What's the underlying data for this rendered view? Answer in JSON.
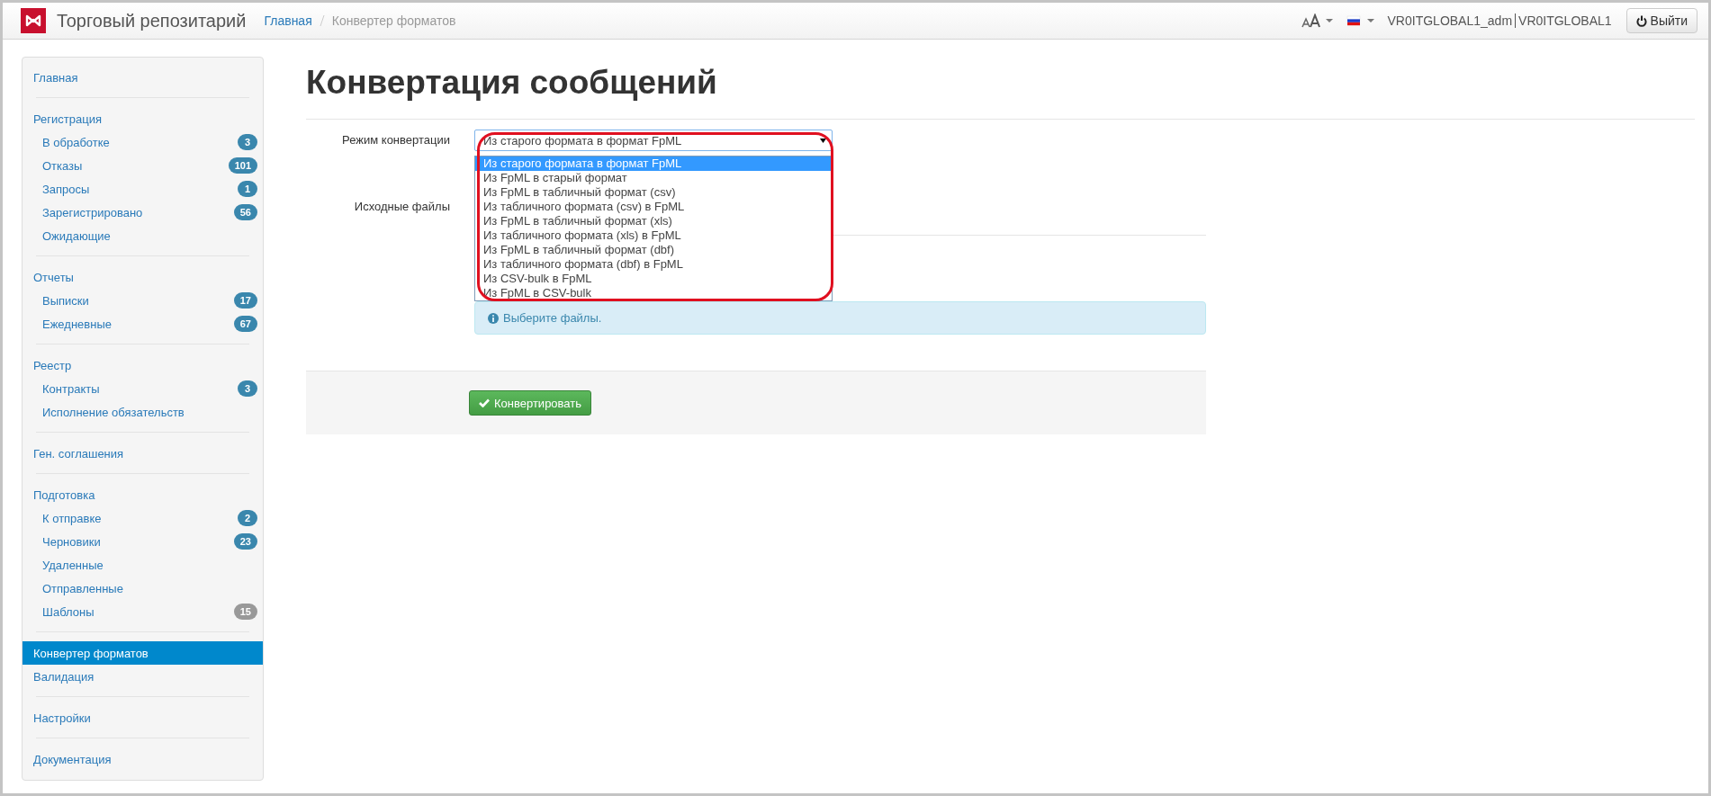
{
  "topbar": {
    "brand": "Торговый репозитарий",
    "breadcrumb": [
      {
        "label": "Главная",
        "link": true
      },
      {
        "label": "Конвертер форматов",
        "link": false
      }
    ],
    "user_login": "VR0ITGLOBAL1_adm",
    "user_org": "VR0ITGLOBAL1",
    "logout": "Выйти"
  },
  "sidebar": {
    "groups": [
      {
        "items": [
          {
            "label": "Главная",
            "selected": false
          }
        ]
      },
      {
        "items": [
          {
            "label": "Регистрация",
            "selected": false,
            "children": [
              {
                "label": "В обработке",
                "badge": "3",
                "color": "#3a87ad",
                "selected": false
              },
              {
                "label": "Отказы",
                "badge": "101",
                "color": "#3a87ad",
                "selected": false
              },
              {
                "label": "Запросы",
                "badge": "1",
                "color": "#3a87ad",
                "selected": false
              },
              {
                "label": "Зарегистрировано",
                "badge": "56",
                "color": "#3a87ad",
                "selected": false
              },
              {
                "label": "Ожидающие",
                "selected": false
              }
            ]
          }
        ]
      },
      {
        "items": [
          {
            "label": "Отчеты",
            "selected": false,
            "children": [
              {
                "label": "Выписки",
                "badge": "17",
                "color": "#3a87ad",
                "selected": false
              },
              {
                "label": "Ежедневные",
                "badge": "67",
                "color": "#3a87ad",
                "selected": false
              }
            ]
          }
        ]
      },
      {
        "items": [
          {
            "label": "Реестр",
            "selected": false,
            "children": [
              {
                "label": "Контракты",
                "badge": "3",
                "color": "#3a87ad",
                "selected": false
              },
              {
                "label": "Исполнение обязательств",
                "selected": false
              }
            ]
          }
        ]
      },
      {
        "items": [
          {
            "label": "Ген. соглашения",
            "selected": false
          }
        ]
      },
      {
        "items": [
          {
            "label": "Подготовка",
            "selected": false,
            "children": [
              {
                "label": "К отправке",
                "badge": "2",
                "color": "#3a87ad",
                "selected": false
              },
              {
                "label": "Черновики",
                "badge": "23",
                "color": "#3a87ad",
                "selected": false
              },
              {
                "label": "Удаленные",
                "selected": false
              },
              {
                "label": "Отправленные",
                "selected": false
              },
              {
                "label": "Шаблоны",
                "badge": "15",
                "color": "#999999",
                "selected": false
              }
            ]
          }
        ]
      },
      {
        "items": [
          {
            "label": "Конвертер форматов",
            "selected": true
          },
          {
            "label": "Валидация",
            "selected": false
          }
        ]
      },
      {
        "items": [
          {
            "label": "Настройки",
            "selected": false
          }
        ]
      },
      {
        "items": [
          {
            "label": "Документация",
            "selected": false
          }
        ]
      }
    ]
  },
  "page": {
    "title": "Конвертация сообщений",
    "mode": {
      "label": "Режим конвертации",
      "value": "Из старого формата в формат FpML",
      "expanded": true,
      "options": [
        {
          "label": "Из старого формата в формат FpML",
          "selected": true
        },
        {
          "label": "Из FpML в старый формат",
          "selected": false
        },
        {
          "label": "Из FpML в табличный формат (csv)",
          "selected": false
        },
        {
          "label": "Из табличного формата (csv) в FpML",
          "selected": false
        },
        {
          "label": "Из FpML в табличный формат (xls)",
          "selected": false
        },
        {
          "label": "Из табличного формата (xls) в FpML",
          "selected": false
        },
        {
          "label": "Из FpML в табличный формат (dbf)",
          "selected": false
        },
        {
          "label": "Из табличного формата (dbf) в FpML",
          "selected": false
        },
        {
          "label": "Из CSV-bulk в FpML",
          "selected": false
        },
        {
          "label": "Из FpML в CSV-bulk",
          "selected": false
        }
      ]
    },
    "files": {
      "label": "Исходные файлы",
      "alert": "Выберите файлы."
    },
    "submit": "Конвертировать"
  }
}
